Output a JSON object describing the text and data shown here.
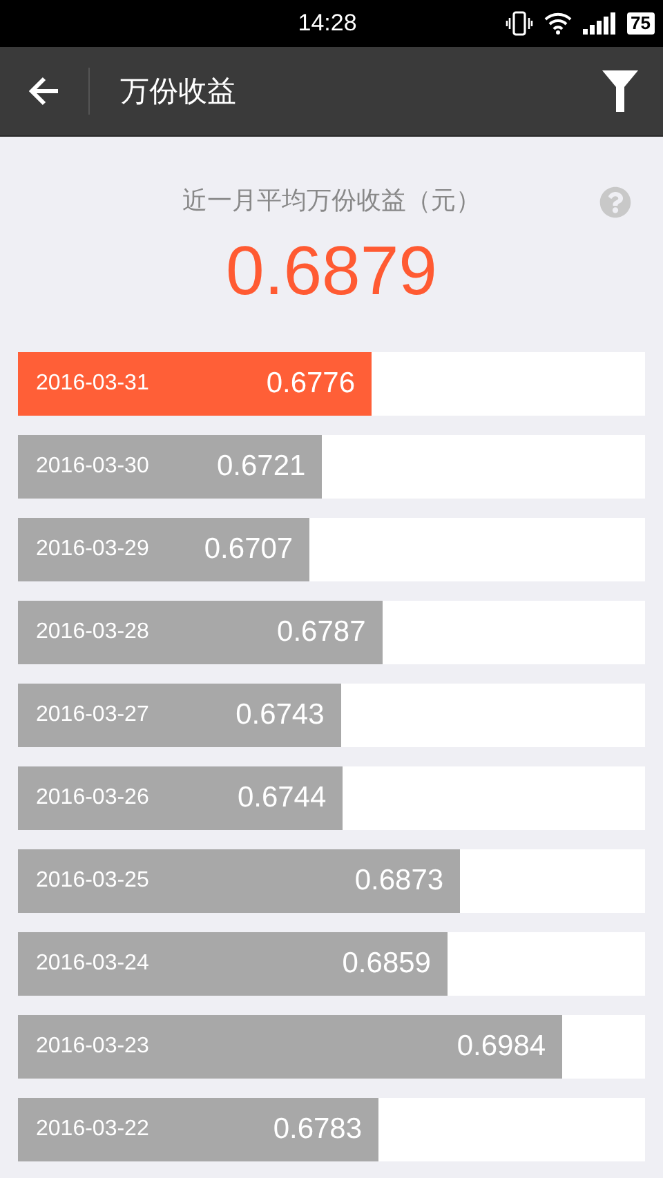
{
  "status_bar": {
    "time": "14:28",
    "battery": "75"
  },
  "header": {
    "title": "万份收益"
  },
  "summary": {
    "label": "近一月平均万份收益（元）",
    "value": "0.6879"
  },
  "rows": [
    {
      "date": "2016-03-31",
      "value": "0.6776",
      "level": 0.564,
      "selected": true
    },
    {
      "date": "2016-03-30",
      "value": "0.6721",
      "level": 0.485,
      "selected": false
    },
    {
      "date": "2016-03-29",
      "value": "0.6707",
      "level": 0.465,
      "selected": false
    },
    {
      "date": "2016-03-28",
      "value": "0.6787",
      "level": 0.581,
      "selected": false
    },
    {
      "date": "2016-03-27",
      "value": "0.6743",
      "level": 0.515,
      "selected": false
    },
    {
      "date": "2016-03-26",
      "value": "0.6744",
      "level": 0.518,
      "selected": false
    },
    {
      "date": "2016-03-25",
      "value": "0.6873",
      "level": 0.705,
      "selected": false
    },
    {
      "date": "2016-03-24",
      "value": "0.6859",
      "level": 0.685,
      "selected": false
    },
    {
      "date": "2016-03-23",
      "value": "0.6984",
      "level": 0.868,
      "selected": false
    },
    {
      "date": "2016-03-22",
      "value": "0.6783",
      "level": 0.575,
      "selected": false
    }
  ]
}
